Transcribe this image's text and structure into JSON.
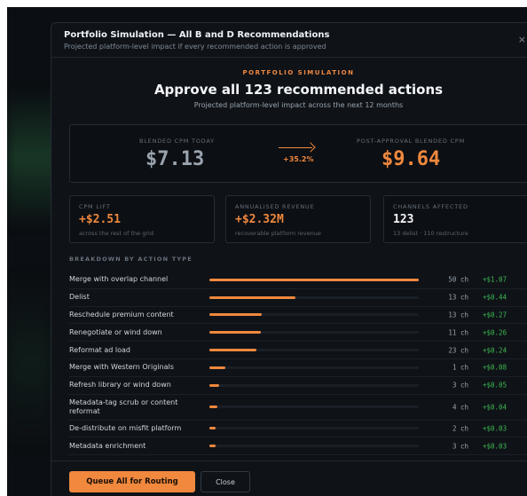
{
  "modal": {
    "title": "Portfolio Simulation — All B and D Recommendations",
    "subtitle": "Projected platform-level impact if every recommended action is approved",
    "close_glyph": "×"
  },
  "hero": {
    "kicker": "PORTFOLIO SIMULATION",
    "headline": "Approve all 123 recommended actions",
    "subhead": "Projected platform-level impact across the next 12 months"
  },
  "cpm": {
    "today_label": "BLENDED CPM TODAY",
    "today_value": "$7.13",
    "change": "+35.2%",
    "after_label": "POST-APPROVAL BLENDED CPM",
    "after_value": "$9.64"
  },
  "stats": [
    {
      "label": "CPM LIFT",
      "value": "+$2.51",
      "note": "across the rest of the grid"
    },
    {
      "label": "ANNUALISED REVENUE",
      "value": "+$2.32M",
      "note": "recoverable platform revenue"
    },
    {
      "label": "CHANNELS AFFECTED",
      "value": "123",
      "note": "13 delist · 110 restructure"
    }
  ],
  "breakdown": {
    "title": "BREAKDOWN BY ACTION TYPE",
    "rows": [
      {
        "label": "Merge with overlap channel",
        "share": 1.0,
        "channels": "50 ch",
        "revenue": "+$1.07"
      },
      {
        "label": "Delist",
        "share": 0.41,
        "channels": "13 ch",
        "revenue": "+$0.44"
      },
      {
        "label": "Reschedule premium content",
        "share": 0.25,
        "channels": "13 ch",
        "revenue": "+$0.27"
      },
      {
        "label": "Renegotiate or wind down",
        "share": 0.245,
        "channels": "11 ch",
        "revenue": "+$0.26"
      },
      {
        "label": "Reformat ad load",
        "share": 0.225,
        "channels": "23 ch",
        "revenue": "+$0.24"
      },
      {
        "label": "Merge with Western Originals",
        "share": 0.075,
        "channels": "1 ch",
        "revenue": "+$0.08"
      },
      {
        "label": "Refresh library or wind down",
        "share": 0.047,
        "channels": "3 ch",
        "revenue": "+$0.05"
      },
      {
        "label": "Metadata-tag scrub or content reformat",
        "share": 0.037,
        "channels": "4 ch",
        "revenue": "+$0.04"
      },
      {
        "label": "De-distribute on misfit platform",
        "share": 0.028,
        "channels": "2 ch",
        "revenue": "+$0.03"
      },
      {
        "label": "Metadata enrichment",
        "share": 0.028,
        "channels": "3 ch",
        "revenue": "+$0.03"
      }
    ]
  },
  "footer": {
    "primary_label": "Queue All for Routing",
    "secondary_label": "Close"
  },
  "colors": {
    "accent": "#f0883e",
    "positive": "#3fb950",
    "muted_value": "#9aa3ae"
  }
}
